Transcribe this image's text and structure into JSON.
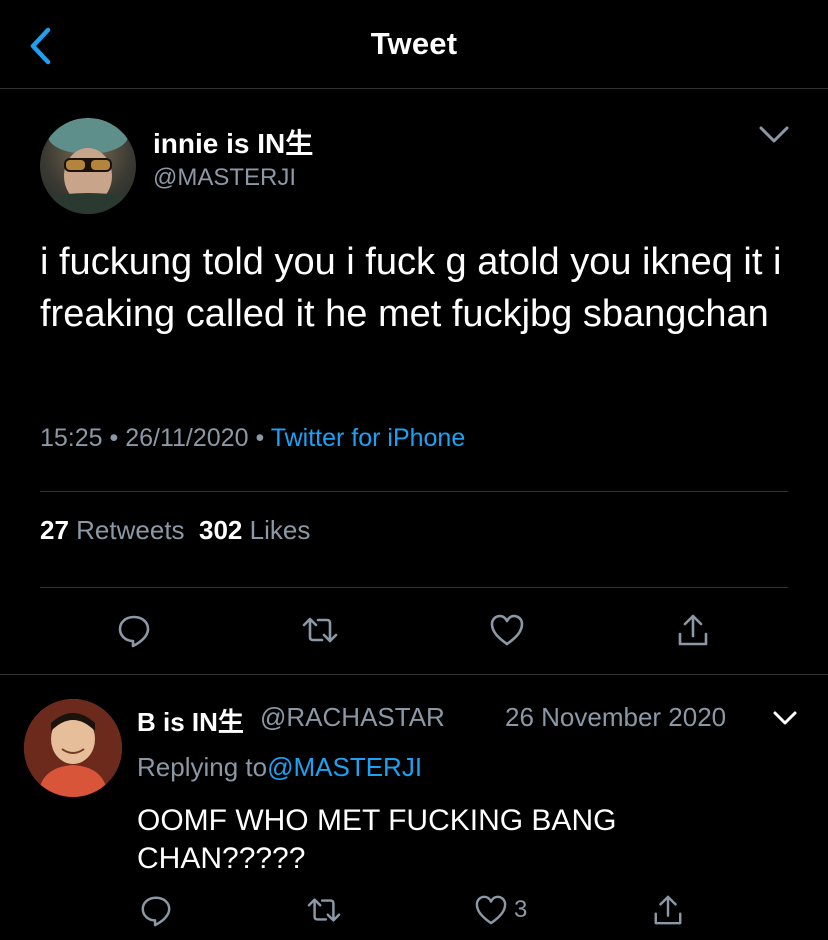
{
  "header": {
    "title": "Tweet",
    "back_icon": "chevron-left-icon"
  },
  "colors": {
    "background": "#000000",
    "accent": "#1da1f2",
    "secondary_text": "#8b98a5",
    "divider": "#2f3336"
  },
  "tweet": {
    "display_name": "innie is IN生",
    "handle": "@MASTERJI",
    "text": "i fuckung told you i fuck g atold you ikneq it i freaking called it he met fuckjbg sbangchan",
    "time": "15:25",
    "separator": " • ",
    "date": "26/11/2020",
    "source": "Twitter for iPhone",
    "retweets_count": "27",
    "retweets_label": "Retweets",
    "likes_count": "302",
    "likes_label": "Likes",
    "actions": [
      "reply-icon",
      "retweet-icon",
      "like-icon",
      "share-icon"
    ]
  },
  "reply": {
    "display_name": "B is IN生",
    "handle": "@RACHASTAR",
    "date": "26 November 2020",
    "replying_prefix": "Replying to",
    "replying_to": "@MASTERJI",
    "text": "OOMF WHO MET FUCKING BANG CHAN?????",
    "like_count": "3",
    "actions": [
      "reply-icon",
      "retweet-icon",
      "like-icon",
      "share-icon"
    ]
  }
}
